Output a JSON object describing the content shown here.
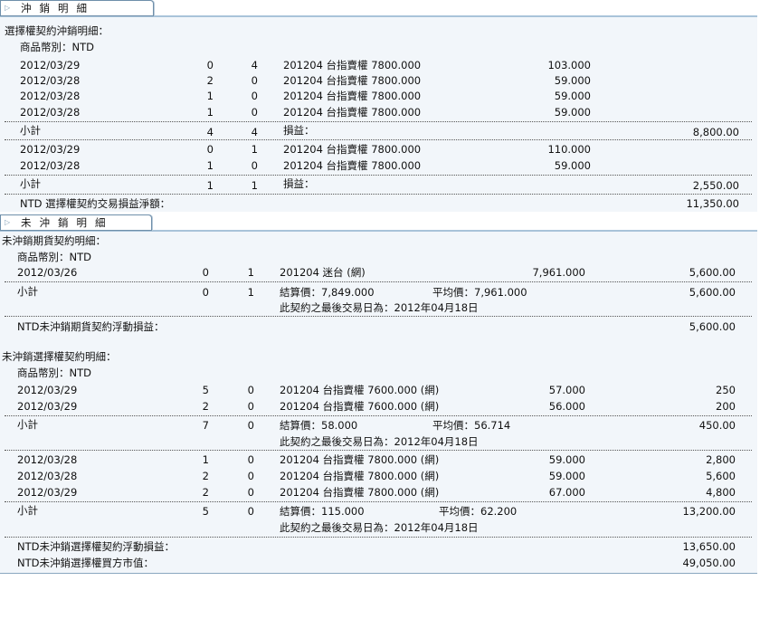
{
  "section_closed": {
    "tab_label": "沖銷明細",
    "title": "選擇權契約沖銷明細：",
    "currency": "商品幣別：NTD",
    "groups": [
      {
        "rows": [
          {
            "date": "2012/03/29",
            "q1": "0",
            "q2": "4",
            "product": "201204 台指賣權 7800.000",
            "price": "103.000"
          },
          {
            "date": "2012/03/28",
            "q1": "2",
            "q2": "0",
            "product": "201204 台指賣權 7800.000",
            "price": "59.000"
          },
          {
            "date": "2012/03/28",
            "q1": "1",
            "q2": "0",
            "product": "201204 台指賣權 7800.000",
            "price": "59.000"
          },
          {
            "date": "2012/03/28",
            "q1": "1",
            "q2": "0",
            "product": "201204 台指賣權 7800.000",
            "price": "59.000"
          }
        ],
        "subtotal": {
          "label": "小計",
          "q1": "4",
          "q2": "4",
          "pl_label": "損益：",
          "amount": "8,800.00"
        }
      },
      {
        "rows": [
          {
            "date": "2012/03/29",
            "q1": "0",
            "q2": "1",
            "product": "201204 台指賣權 7800.000",
            "price": "110.000"
          },
          {
            "date": "2012/03/28",
            "q1": "1",
            "q2": "0",
            "product": "201204 台指賣權 7800.000",
            "price": "59.000"
          }
        ],
        "subtotal": {
          "label": "小計",
          "q1": "1",
          "q2": "1",
          "pl_label": "損益：",
          "amount": "2,550.00"
        }
      }
    ],
    "net": {
      "label": "NTD 選擇權契約交易損益淨額：",
      "amount": "11,350.00"
    }
  },
  "section_open": {
    "tab_label": "未沖銷明細",
    "futures": {
      "title": "未沖銷期貨契約明細：",
      "currency": "商品幣別：NTD",
      "rows": [
        {
          "date": "2012/03/26",
          "q1": "0",
          "q2": "1",
          "product": "201204 迷台 (網)",
          "price": "7,961.000",
          "amount": "5,600.00"
        }
      ],
      "subtotal": {
        "label": "小計",
        "q1": "0",
        "q2": "1",
        "settle": "結算價：7,849.000",
        "avg": "平均價：7,961.000",
        "amount": "5,600.00",
        "last_day": "此契約之最後交易日為：2012年04月18日"
      },
      "float": {
        "label": "NTD未沖銷期貨契約浮動損益：",
        "amount": "5,600.00"
      }
    },
    "options": {
      "title": "未沖銷選擇權契約明細：",
      "currency": "商品幣別：NTD",
      "groups": [
        {
          "rows": [
            {
              "date": "2012/03/29",
              "q1": "5",
              "q2": "0",
              "product": "201204 台指賣權 7600.000 (網)",
              "price": "57.000",
              "amount": "250"
            },
            {
              "date": "2012/03/29",
              "q1": "2",
              "q2": "0",
              "product": "201204 台指賣權 7600.000 (網)",
              "price": "56.000",
              "amount": "200"
            }
          ],
          "subtotal": {
            "label": "小計",
            "q1": "7",
            "q2": "0",
            "settle": "結算價：58.000",
            "avg": "平均價：56.714",
            "amount": "450.00",
            "last_day": "此契約之最後交易日為：2012年04月18日"
          }
        },
        {
          "rows": [
            {
              "date": "2012/03/28",
              "q1": "1",
              "q2": "0",
              "product": "201204 台指賣權 7800.000 (網)",
              "price": "59.000",
              "amount": "2,800"
            },
            {
              "date": "2012/03/28",
              "q1": "2",
              "q2": "0",
              "product": "201204 台指賣權 7800.000 (網)",
              "price": "59.000",
              "amount": "5,600"
            },
            {
              "date": "2012/03/29",
              "q1": "2",
              "q2": "0",
              "product": "201204 台指賣權 7800.000 (網)",
              "price": "67.000",
              "amount": "4,800"
            }
          ],
          "subtotal": {
            "label": "小計",
            "q1": "5",
            "q2": "0",
            "settle": "結算價：115.000",
            "avg": "平均價：62.200",
            "amount": "13,200.00",
            "last_day": "此契約之最後交易日為：2012年04月18日"
          }
        }
      ],
      "float": {
        "label": "NTD未沖銷選擇權契約浮動損益：",
        "amount": "13,650.00"
      },
      "market_value": {
        "label": "NTD未沖銷選擇權買方市值：",
        "amount": "49,050.00"
      }
    }
  }
}
